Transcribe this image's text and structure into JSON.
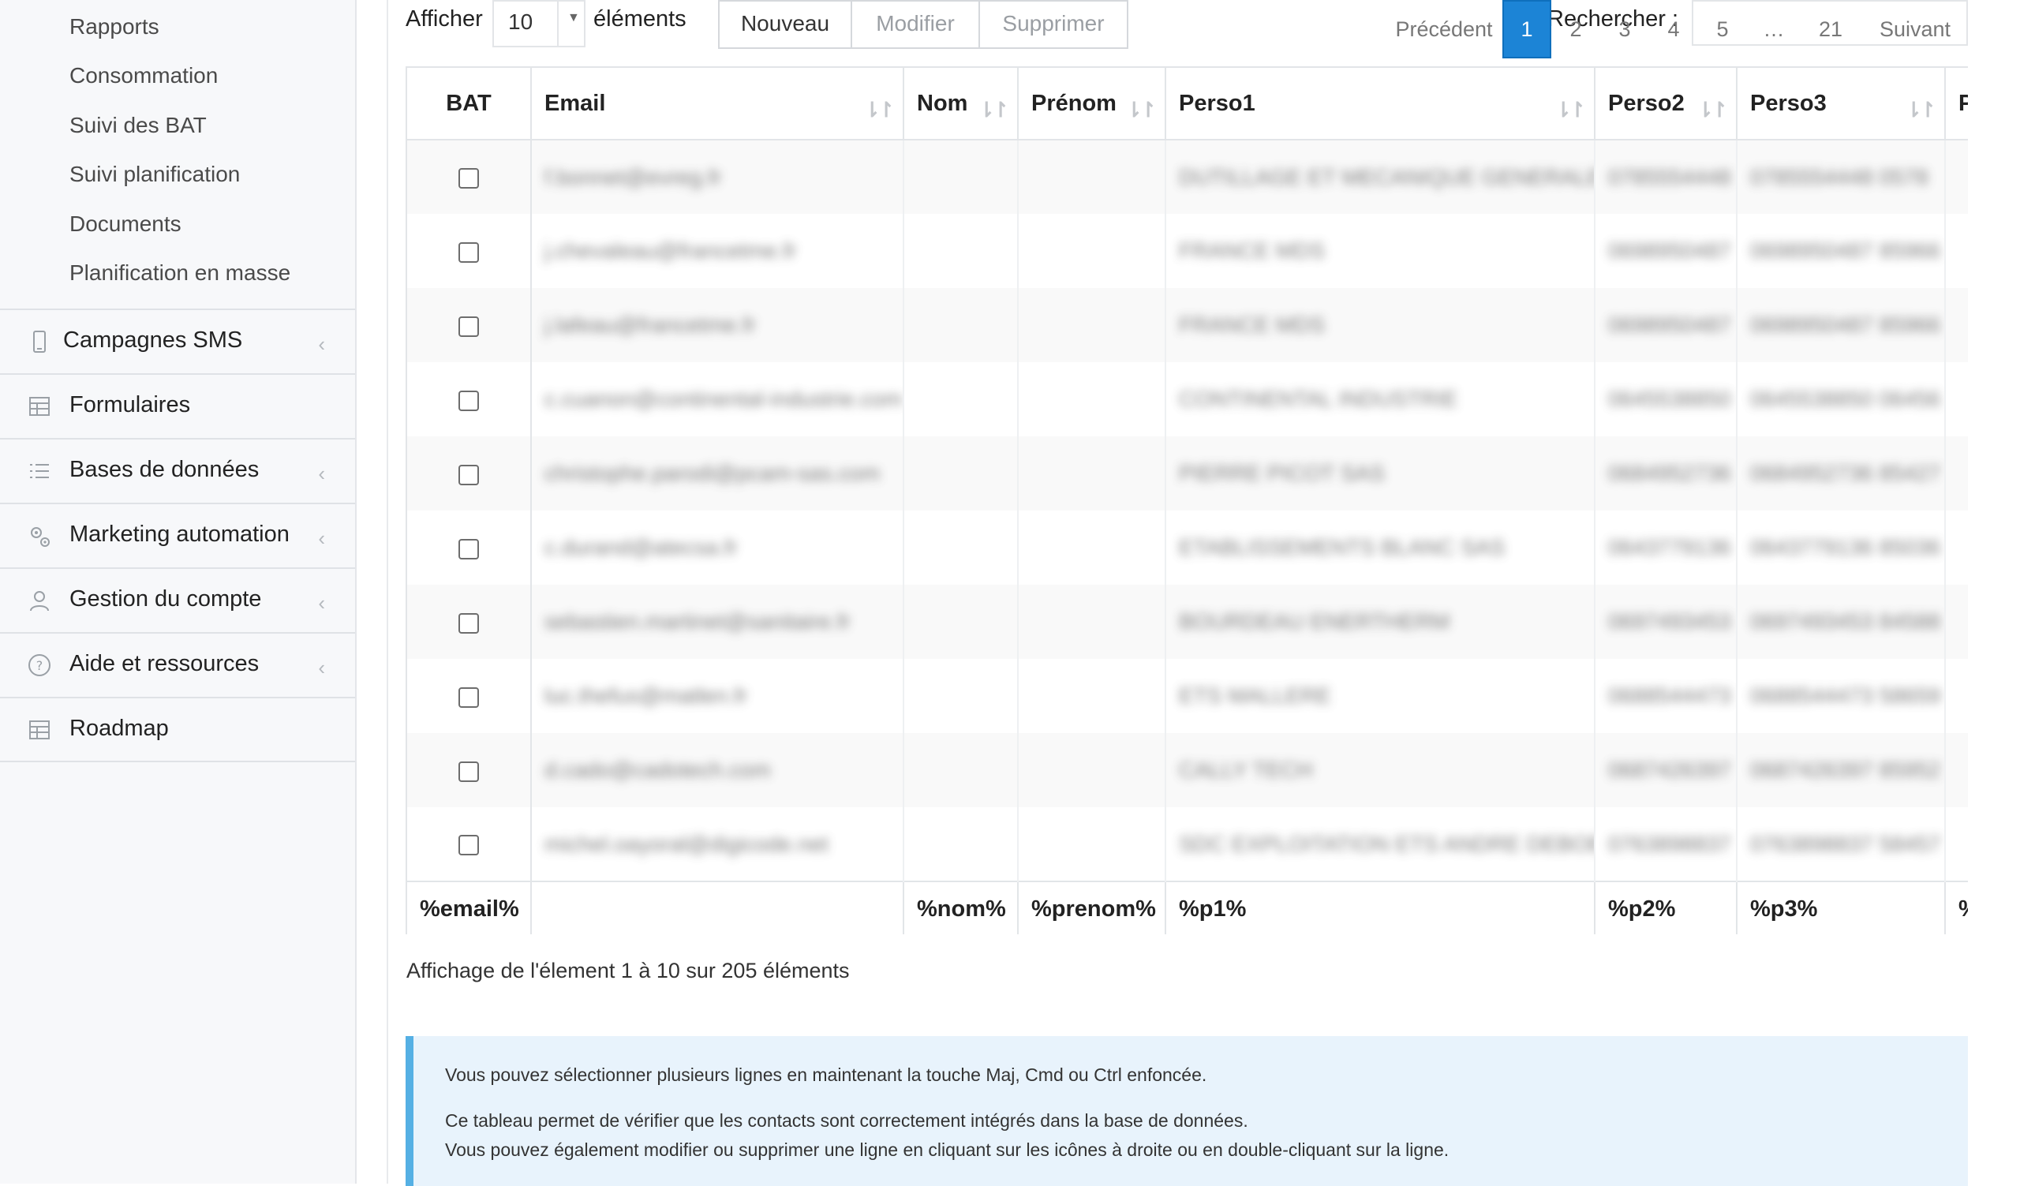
{
  "sidebar": {
    "sub_items": [
      "Rapports",
      "Consommation",
      "Suivi des BAT",
      "Suivi planification",
      "Documents",
      "Planification en masse"
    ],
    "nav": [
      {
        "label": "Campagnes SMS",
        "icon": "mobile-icon",
        "chevron": "‹"
      },
      {
        "label": "Formulaires",
        "icon": "table-icon",
        "chevron": ""
      },
      {
        "label": "Bases de données",
        "icon": "list-icon",
        "chevron": "‹"
      },
      {
        "label": "Marketing automation",
        "icon": "gears-icon",
        "chevron": "‹"
      },
      {
        "label": "Gestion du compte",
        "icon": "user-icon",
        "chevron": "‹"
      },
      {
        "label": "Aide et ressources",
        "icon": "question-circle-icon",
        "chevron": "‹"
      },
      {
        "label": "Roadmap",
        "icon": "table-icon",
        "chevron": ""
      }
    ]
  },
  "toolbar": {
    "show_label": "Afficher",
    "length_value": "10",
    "length_arrow": "▼",
    "elements_label": "éléments",
    "new_label": "Nouveau",
    "edit_label": "Modifier",
    "delete_label": "Supprimer",
    "search_label": "Rechercher :",
    "search_value": ""
  },
  "table": {
    "sort_glyph": "⇂↾",
    "headers": [
      "BAT",
      "Email",
      "Nom",
      "Prénom",
      "Perso1",
      "Perso2",
      "Perso3",
      "Pe"
    ],
    "rows": [
      {
        "email": "f.bonnet@evreg.fr",
        "p1": "DUTILLAGE ET MECANIQUE GENERALE",
        "p2": "0785554448",
        "p3": "0785554448 0578"
      },
      {
        "email": "j.chevaleau@francetme.fr",
        "p1": "FRANCE MDS",
        "p2": "0698950487",
        "p3": "0698950487 85966"
      },
      {
        "email": "j.lafeau@francetme.fr",
        "p1": "FRANCE MDS",
        "p2": "0698950487",
        "p3": "0698950487 85966"
      },
      {
        "email": "c.cuanon@continental-industrie.com",
        "p1": "CONTINENTAL INDUSTRIE",
        "p2": "0645538850",
        "p3": "0645538850 06456"
      },
      {
        "email": "christophe.parodi@pcam-sas.com",
        "p1": "PIERRE PICOT SAS",
        "p2": "0684952736",
        "p3": "0684952736 85427"
      },
      {
        "email": "c.durand@atecsa.fr",
        "p1": "ETABLISSEMENTS BLANC SAS",
        "p2": "0643779136",
        "p3": "0643779136 85036"
      },
      {
        "email": "sebastien.martinet@sanitaire.fr",
        "p1": "BOURDEAU ENERTHERM",
        "p2": "0697493453",
        "p3": "0697493453 84588"
      },
      {
        "email": "luc.thefus@matlen.fr",
        "p1": "ETS MALLERE",
        "p2": "0688544473",
        "p3": "0688544473 58659"
      },
      {
        "email": "d.cado@cadotech.com",
        "p1": "CALLY TECH",
        "p2": "0687426397",
        "p3": "0687426397 85952"
      },
      {
        "email": "michel.oayoral@digicode.net",
        "p1": "SDC EXPLOITATION ETS ANDRE DEBOER",
        "p2": "0763898837",
        "p3": "0763898837 58457"
      }
    ],
    "footer": [
      "%email%",
      "",
      "%nom%",
      "%prenom%",
      "%p1%",
      "%p2%",
      "%p3%",
      "%"
    ]
  },
  "info_text": "Affichage de l'élement 1 à 10 sur 205 éléments",
  "pagination": {
    "prev": "Précédent",
    "pages": [
      "1",
      "2",
      "3",
      "4",
      "5",
      "…",
      "21"
    ],
    "next": "Suivant",
    "active": "1"
  },
  "notice": {
    "line1": "Vous pouvez sélectionner plusieurs lignes en maintenant la touche Maj, Cmd ou Ctrl enfoncée.",
    "line2": "Ce tableau permet de vérifier que les contacts sont correctement intégrés dans la base de données.",
    "line3": "Vous pouvez également modifier ou supprimer une ligne en cliquant sur les icônes à droite ou en double-cliquant sur la ligne."
  },
  "colors": {
    "accent": "#1c84d6",
    "notice_bg": "#e8f3fc",
    "notice_border": "#55b0e4"
  }
}
